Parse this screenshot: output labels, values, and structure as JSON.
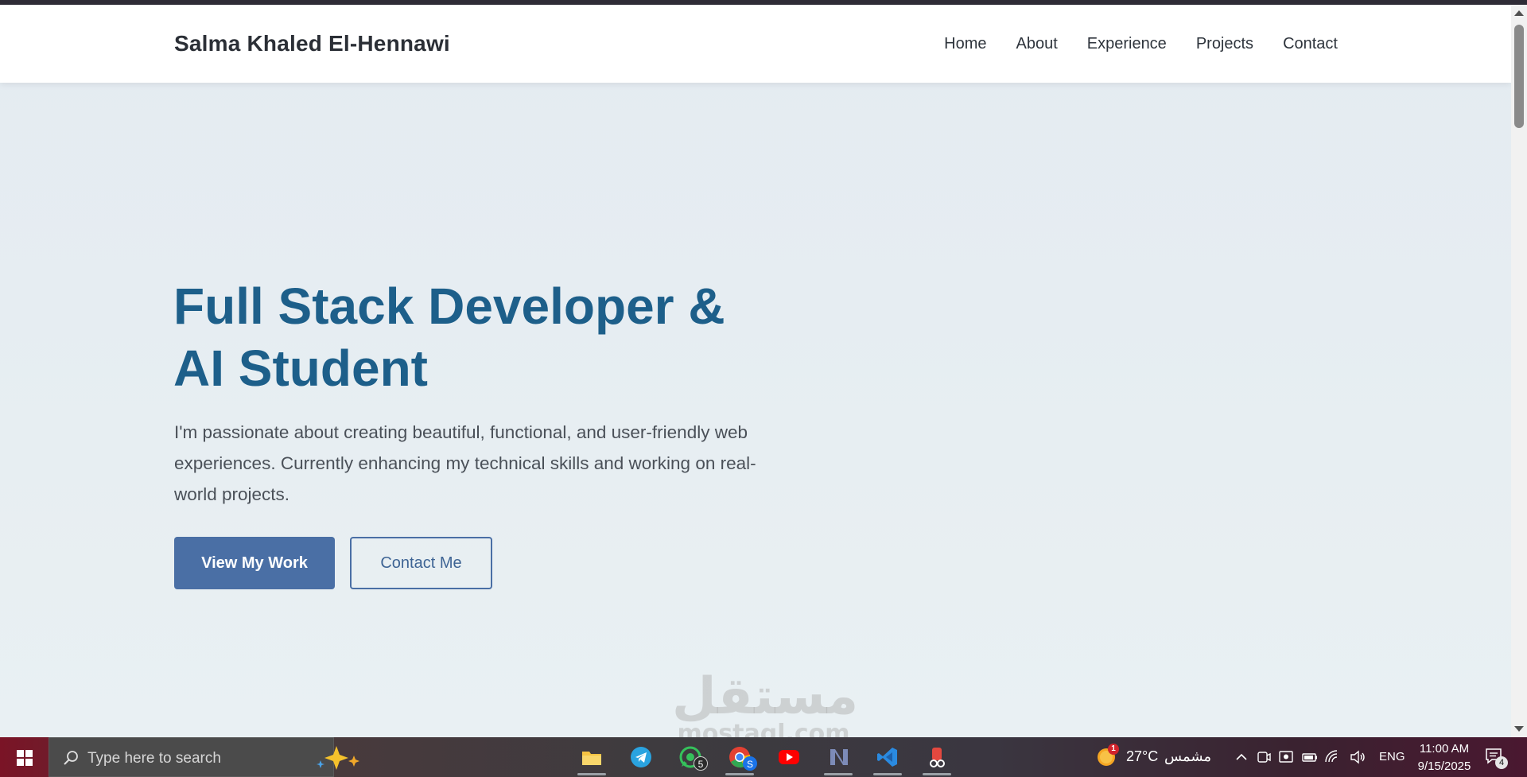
{
  "nav": {
    "brand": "Salma Khaled El-Hennawi",
    "links": [
      "Home",
      "About",
      "Experience",
      "Projects",
      "Contact"
    ]
  },
  "hero": {
    "title_line1": "Full Stack Developer &",
    "title_line2": "AI Student",
    "description": "I'm passionate about creating beautiful, functional, and user-friendly web experiences. Currently enhancing my technical skills and working on real-world projects.",
    "primary_button": "View My Work",
    "secondary_button": "Contact Me"
  },
  "watermark": {
    "arabic": "مستقل",
    "latin": "mostaql.com"
  },
  "taskbar": {
    "search_placeholder": "Type here to search",
    "whatsapp_badge": "5",
    "chrome_badge": "S",
    "weather_temp": "27°C",
    "weather_desc": "مشمس",
    "weather_alert": "1",
    "language": "ENG",
    "time": "11:00 AM",
    "date": "9/15/2025",
    "notification_count": "4",
    "apps": [
      "file-explorer-icon",
      "telegram-icon",
      "whatsapp-icon",
      "chrome-icon",
      "youtube-icon",
      "visual-studio-icon",
      "vscode-icon",
      "snipping-tool-icon"
    ]
  },
  "colors": {
    "title": "#1d5f8a",
    "primary_button": "#4a6fa5",
    "navbar_bg": "#ffffff",
    "hero_bg": "#e6edf2"
  }
}
